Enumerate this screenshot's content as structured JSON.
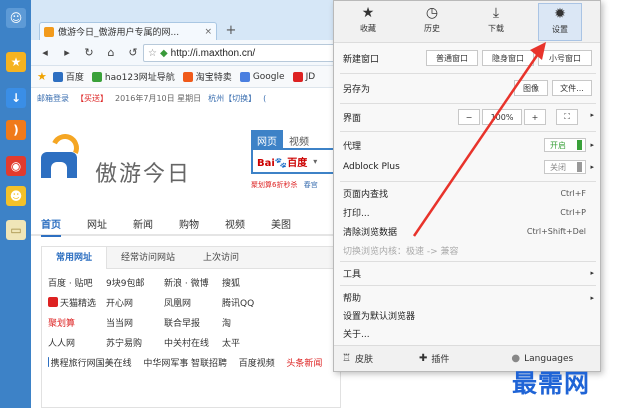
{
  "sidebar": {
    "icons": [
      {
        "name": "smile-icon",
        "glyph": "☺",
        "color": "#9fc6ec"
      },
      {
        "name": "star-icon",
        "glyph": "★",
        "color": "#f5b320"
      },
      {
        "name": "download-icon",
        "glyph": "↓",
        "color": "#3a8ee6"
      },
      {
        "name": "rss-icon",
        "glyph": ")",
        "color": "#f07a1a"
      },
      {
        "name": "weibo-icon",
        "glyph": "◉",
        "color": "#e23b2e"
      },
      {
        "name": "emoticon-icon",
        "glyph": "☻",
        "color": "#f3c12a"
      },
      {
        "name": "note-icon",
        "glyph": "▭",
        "color": "#f0e6b8"
      }
    ]
  },
  "browser": {
    "tab_title": "傲游今日_傲游用户专属的网...",
    "tab_close": "×",
    "new_tab": "+",
    "address": "http://i.maxthon.cn/",
    "bookmarks": [
      {
        "label": "百度",
        "color": "#2d6fc1"
      },
      {
        "label": "hao123网址导航",
        "color": "#3aa13a"
      },
      {
        "label": "淘宝特卖",
        "color": "#f05a1a"
      },
      {
        "label": "Google",
        "color": "#4a7fe0"
      },
      {
        "label": "JD",
        "color": "#d22"
      }
    ],
    "infobar": [
      "邮箱登录",
      "【买送】",
      "2016年7月10日 星期日",
      "杭州【切换】",
      "("
    ]
  },
  "page": {
    "site_name": "傲游今日",
    "search_tabs": [
      "网页",
      "视频"
    ],
    "search_engine_a": "Bai",
    "search_engine_b": "du",
    "search_engine_c": "百度",
    "promo_red": "聚划算6折秒杀",
    "promo_blue": "春宫",
    "nav_tabs": [
      "首页",
      "网址",
      "新闻",
      "购物",
      "视频",
      "美图"
    ],
    "link_tabs": [
      "常用网址",
      "经常访问网站",
      "上次访问"
    ],
    "link_rows": [
      [
        {
          "t": "百度 · 贴吧"
        },
        {
          "t": "9块9包邮"
        },
        {
          "t": "新浪 · 微博"
        },
        {
          "t": "搜狐"
        }
      ],
      [
        {
          "t": "天猫精选",
          "icon": "#d22"
        },
        {
          "t": "开心网"
        },
        {
          "t": "凤凰网"
        },
        {
          "t": "腾讯QQ"
        }
      ],
      [
        {
          "t": "聚划算",
          "red": true
        },
        {
          "t": "当当网"
        },
        {
          "t": "联合早报"
        },
        {
          "t": "淘"
        }
      ],
      [
        {
          "t": "人人网"
        },
        {
          "t": "苏宁易购"
        },
        {
          "t": "中关村在线"
        },
        {
          "t": "太平"
        }
      ],
      [
        {
          "t": "携程旅行网",
          "icon": "#2d6fc1"
        },
        {
          "t": "国美在线"
        },
        {
          "t": "中华网军事"
        },
        {
          "t": "智联招聘"
        },
        {
          "t": "百度视频"
        },
        {
          "t": "头条新闻",
          "red": true
        }
      ]
    ]
  },
  "menu": {
    "top_buttons": [
      {
        "name": "favorites",
        "icon": "★",
        "label": "收藏"
      },
      {
        "name": "history",
        "icon": "◷",
        "label": "历史"
      },
      {
        "name": "downloads",
        "icon": "⤓",
        "label": "下载"
      },
      {
        "name": "settings",
        "icon": "✹",
        "label": "设置"
      }
    ],
    "new_window": "新建窗口",
    "window_options": [
      "普通窗口",
      "隐身窗口",
      "小号窗口"
    ],
    "save_as": "另存为",
    "save_options": [
      "图像",
      "文件..."
    ],
    "view": "界面",
    "zoom_minus": "−",
    "zoom_value": "100%",
    "zoom_plus": "+",
    "zoom_fit": "⛶",
    "proxy": "代理",
    "proxy_state": "开启",
    "adblock": "Adblock Plus",
    "adblock_state": "关闭",
    "find": "页面内查找",
    "find_shortcut": "Ctrl+F",
    "print": "打印...",
    "print_shortcut": "Ctrl+P",
    "clear_data": "清除浏览数据",
    "clear_shortcut": "Ctrl+Shift+Del",
    "switch_core": "切换浏览内核：极速 -> 兼容",
    "tools": "工具",
    "help": "帮助",
    "set_default": "设置为默认浏览器",
    "about": "关于...",
    "bottom_skin": "皮肤",
    "bottom_plugins": "插件",
    "bottom_languages": "Languages",
    "submenu_arrow": "▸"
  },
  "watermark": "最需网",
  "colors": {
    "accent_blue": "#3d82c7",
    "arrow_red": "#e8332b",
    "toggle_on": "#3aa13a",
    "toggle_off": "#999999"
  }
}
